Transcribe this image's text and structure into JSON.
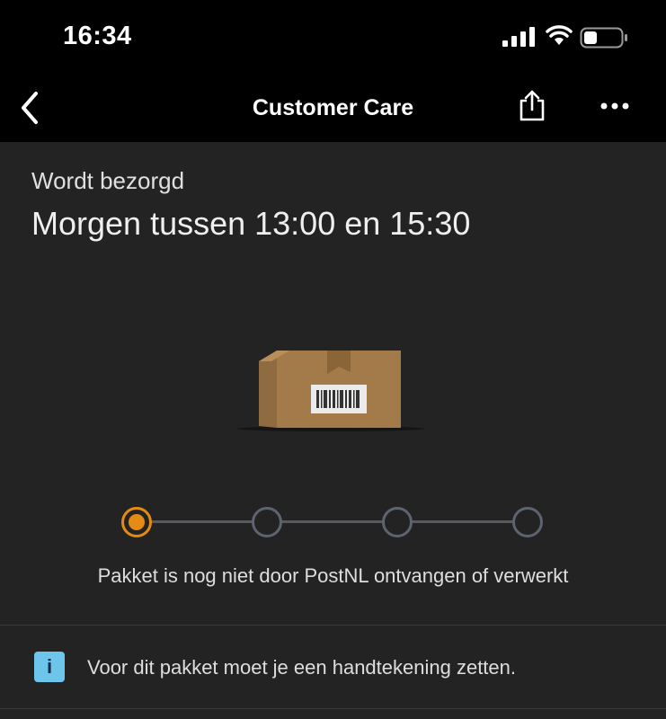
{
  "status_bar": {
    "time": "16:34",
    "icons": [
      "signal-icon",
      "wifi-icon",
      "battery-icon"
    ]
  },
  "nav": {
    "title": "Customer Care",
    "icons": [
      "chevron-left-icon",
      "share-icon",
      "more-icon"
    ]
  },
  "delivery": {
    "status_label": "Wordt bezorgd",
    "window": "Morgen tussen 13:00 en 15:30",
    "illustration": "package-icon"
  },
  "progress": {
    "total_steps": 4,
    "current_step": 1,
    "accent_color": "#e58b14",
    "message": "Pakket is nog niet door PostNL ontvangen of verwerkt"
  },
  "info": {
    "icon_symbol": "i",
    "icon_color": "#6ec5ec",
    "text": "Voor dit pakket moet je een handtekening zetten."
  }
}
